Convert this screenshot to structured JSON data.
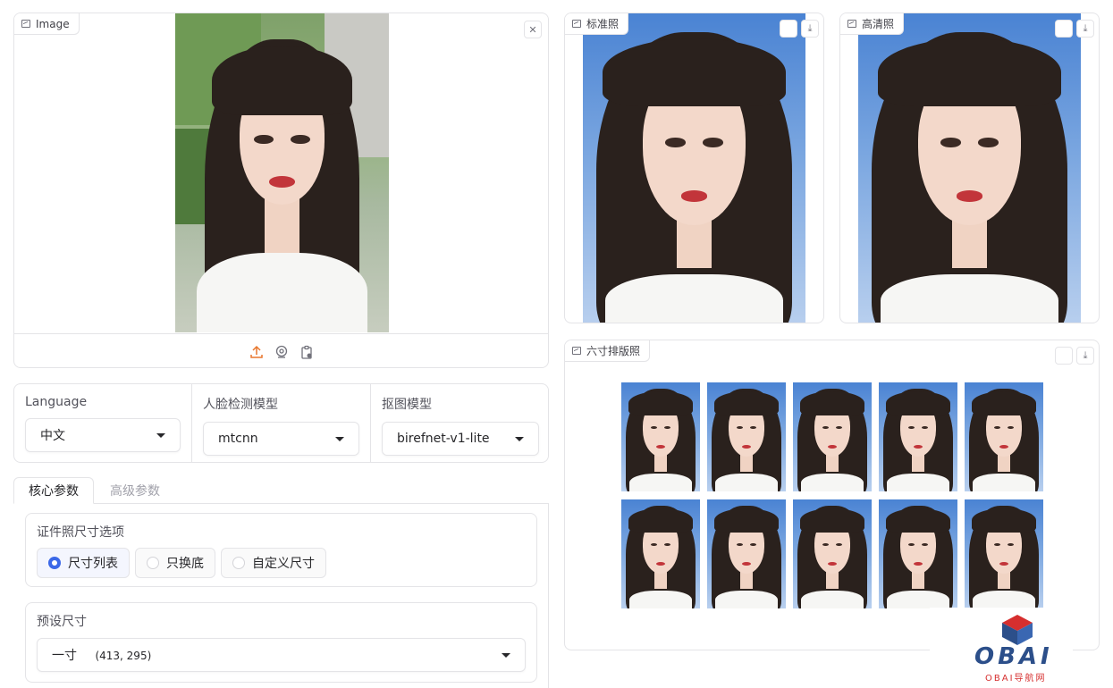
{
  "input_image": {
    "label": "Image",
    "close_icon": "close-icon",
    "toolbar_icons": [
      "upload-icon",
      "webcam-icon",
      "clipboard-icon"
    ]
  },
  "outputs": {
    "standard": {
      "label": "标准照"
    },
    "hd": {
      "label": "高清照"
    },
    "layout": {
      "label": "六寸排版照"
    }
  },
  "settings": {
    "language": {
      "label": "Language",
      "value": "中文"
    },
    "face_model": {
      "label": "人脸检测模型",
      "value": "mtcnn"
    },
    "matting_model": {
      "label": "抠图模型",
      "value": "birefnet-v1-lite"
    }
  },
  "tabs": [
    {
      "label": "核心参数",
      "active": true
    },
    {
      "label": "高级参数",
      "active": false
    }
  ],
  "size_options": {
    "label": "证件照尺寸选项",
    "options": [
      {
        "label": "尺寸列表",
        "selected": true
      },
      {
        "label": "只换底",
        "selected": false
      },
      {
        "label": "自定义尺寸",
        "selected": false
      }
    ]
  },
  "preset_size": {
    "label": "预设尺寸",
    "value": "一寸",
    "dims": "(413, 295)"
  },
  "watermark": {
    "brand": "OBAI",
    "sub": "OBAI导航网"
  },
  "colors": {
    "accent": "#3b68e8",
    "upload_icon": "#e8772e",
    "id_background": "#5b8fd9"
  }
}
